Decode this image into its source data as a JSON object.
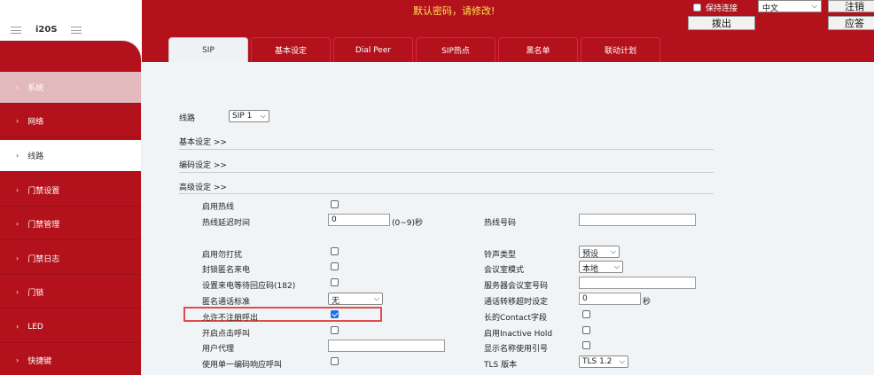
{
  "header": {
    "model": "i20S",
    "warning": "默认密码，请修改!",
    "keep_connection": "保持连接",
    "language": "中文",
    "logout": "注销",
    "dial": "拨出",
    "answer": "应答"
  },
  "tabs": [
    {
      "label": "SIP",
      "active": true
    },
    {
      "label": "基本设定",
      "active": false
    },
    {
      "label": "Dial Peer",
      "active": false
    },
    {
      "label": "SIP热点",
      "active": false
    },
    {
      "label": "黑名单",
      "active": false
    },
    {
      "label": "联动计划",
      "active": false
    }
  ],
  "sidebar": {
    "items": [
      {
        "label": "系统"
      },
      {
        "label": "网络"
      },
      {
        "label": "线路"
      },
      {
        "label": "门禁设置"
      },
      {
        "label": "门禁管理"
      },
      {
        "label": "门禁日志"
      },
      {
        "label": "门锁"
      },
      {
        "label": "LED"
      },
      {
        "label": "快捷键"
      }
    ]
  },
  "content": {
    "line_label": "线路",
    "line_value": "SIP 1",
    "sections": {
      "basic": "基本设定 >>",
      "codec": "编码设定 >>",
      "advanced": "高级设定 >>"
    },
    "fields": {
      "hotline_enable": "启用热线",
      "hotline_delay": "热线延迟时间",
      "hotline_delay_value": "0",
      "hotline_delay_range": "(0~9)秒",
      "hotline_number": "热线号码",
      "dnd": "启用勿打扰",
      "block_anon": "封锁匿名来电",
      "set_wait_code": "设置来电等待回应码(182)",
      "anon_std": "匿名通话标准",
      "anon_std_value": "无",
      "allow_unreg": "允许不注册呼出",
      "click_call": "开启点击呼叫",
      "user_agent": "用户代理",
      "single_codec": "使用单一编码响应呼叫",
      "ring_type": "铃声类型",
      "ring_type_value": "预设",
      "conf_mode": "会议室模式",
      "conf_mode_value": "本地",
      "server_conf": "服务器会议室号码",
      "transfer_timeout": "通话转移超时设定",
      "transfer_timeout_value": "0",
      "transfer_unit": "秒",
      "long_contact": "长的Contact字段",
      "inactive_hold": "启用Inactive Hold",
      "display_name": "显示名称使用引号",
      "tls_version": "TLS 版本",
      "tls_value": "TLS 1.2"
    }
  },
  "colors": {
    "brand_red": "#b3121c",
    "warning_yellow": "#ffe14d",
    "highlight": "#e14b4b",
    "checkbox_checked": "#1a73e8"
  }
}
